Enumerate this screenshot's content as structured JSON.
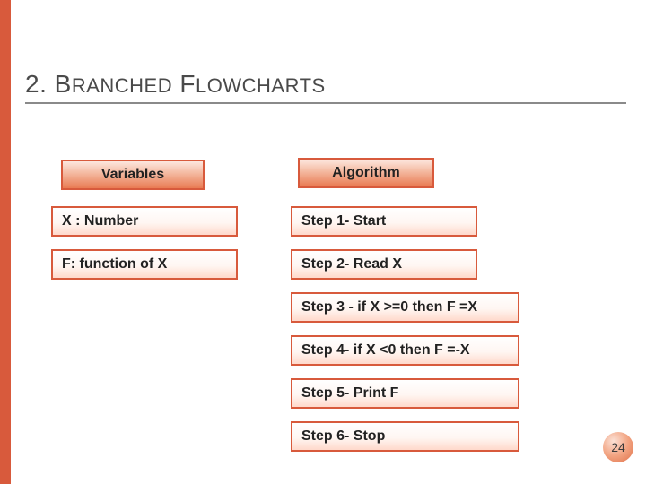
{
  "title": {
    "full": "2. BRANCHED FLOWCHARTS",
    "n": "2. ",
    "b1": "B",
    "r1": "RANCHED",
    "sp": " ",
    "b2": "F",
    "r2": "LOWCHARTS"
  },
  "headers": {
    "variables": "Variables",
    "algorithm": "Algorithm"
  },
  "variables": {
    "v1": "X : Number",
    "v2": "F: function of X"
  },
  "steps": {
    "s1": "Step 1- Start",
    "s2": "Step 2- Read X",
    "s3": "Step 3 - if X >=0 then F =X",
    "s4": "Step 4- if X <0 then F =-X",
    "s5": "Step 5- Print F",
    "s6": "Step 6- Stop"
  },
  "page_number": "24"
}
